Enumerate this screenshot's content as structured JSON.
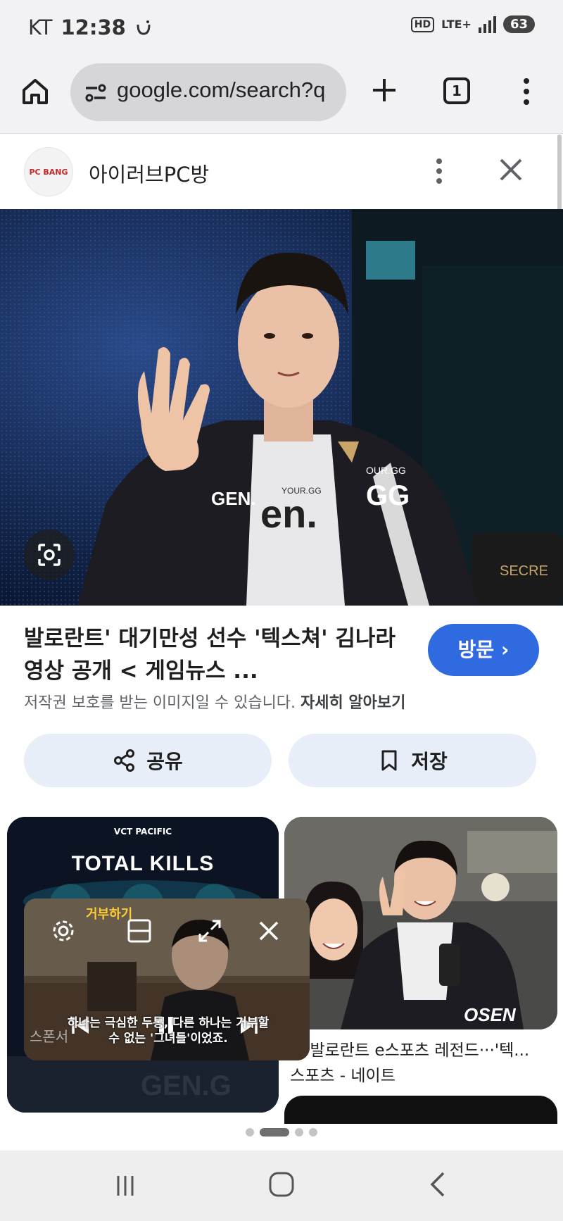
{
  "status_bar": {
    "carrier": "KT",
    "time": "12:38",
    "hd_badge": "HD",
    "network": "LTE+",
    "battery": "63"
  },
  "browser": {
    "url": "google.com/search?q",
    "tab_count": "1",
    "icons": [
      "home-icon",
      "site-info-icon",
      "plus-icon",
      "tabs-icon",
      "more-vert-icon"
    ]
  },
  "viewer": {
    "site_logo_text": "PC BANG",
    "site_name": "아이러브PC방",
    "icons": [
      "more-vert-icon",
      "close-icon",
      "lens-icon"
    ]
  },
  "result": {
    "title": "발로란트' 대기만성 선수 '텍스쳐' 김나라 영상 공개 < 게임뉴스 ...",
    "visit_label": "방문 ›",
    "copyright_text": "저작권 보호를 받는 이미지일 수 있습니다.",
    "learn_more": "자세히 알아보기",
    "share_label": "공유",
    "save_label": "저장"
  },
  "related": {
    "left_card_title": "TOTAL KILLS",
    "left_card_logo": "VCT PACIFIC",
    "right_caption": "국 발로란트 e스포츠 레전드···'텍...",
    "right_source": "스포츠 - 네이트",
    "right_watermark": "OSEN"
  },
  "pip_video": {
    "top_text": "거부하기",
    "subtitle_line1": "하나는 극심한 두통, 다른 하나는 거부할",
    "subtitle_line2": "수 없는 '그녀들'이었죠.",
    "left_label": "스폰서",
    "icons": [
      "settings-icon",
      "resize-icon",
      "expand-icon",
      "close-icon",
      "previous-icon",
      "pause-icon",
      "next-icon"
    ]
  },
  "colors": {
    "accent_blue": "#2f6ae0",
    "chip_bg": "#e8eef8",
    "toolbar_bg": "#f2f2f4"
  }
}
